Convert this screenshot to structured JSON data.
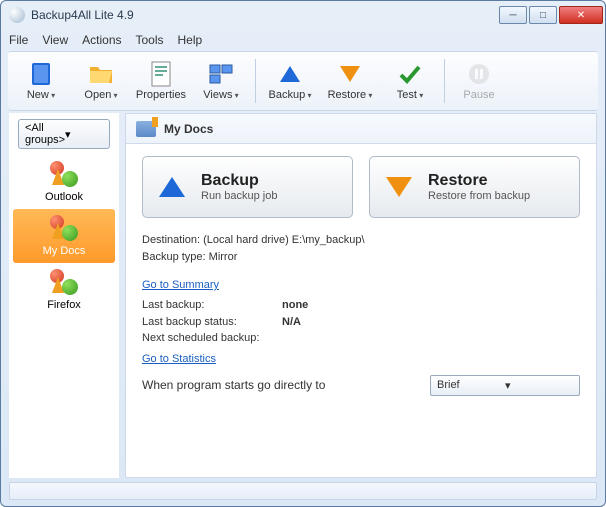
{
  "window": {
    "title": "Backup4All Lite 4.9"
  },
  "menu": {
    "file": "File",
    "view": "View",
    "actions": "Actions",
    "tools": "Tools",
    "help": "Help"
  },
  "toolbar": {
    "new": "New",
    "open": "Open",
    "properties": "Properties",
    "views": "Views",
    "backup": "Backup",
    "restore": "Restore",
    "test": "Test",
    "pause": "Pause"
  },
  "sidebar": {
    "group_selector": "<All groups>",
    "items": [
      {
        "label": "Outlook"
      },
      {
        "label": "My Docs"
      },
      {
        "label": "Firefox"
      }
    ]
  },
  "main": {
    "header_title": "My Docs",
    "backup_btn": {
      "title": "Backup",
      "subtitle": "Run backup job"
    },
    "restore_btn": {
      "title": "Restore",
      "subtitle": "Restore from backup"
    },
    "destination_label": "Destination: (Local hard drive) E:\\my_backup\\",
    "backup_type_label": "Backup type: Mirror",
    "link_summary": "Go to Summary",
    "last_backup_label": "Last backup:",
    "last_backup_value": "none",
    "last_status_label": "Last backup status:",
    "last_status_value": "N/A",
    "next_sched_label": "Next scheduled backup:",
    "next_sched_value": "",
    "link_statistics": "Go to Statistics",
    "startup_label": "When program starts go directly to",
    "startup_value": "Brief"
  }
}
